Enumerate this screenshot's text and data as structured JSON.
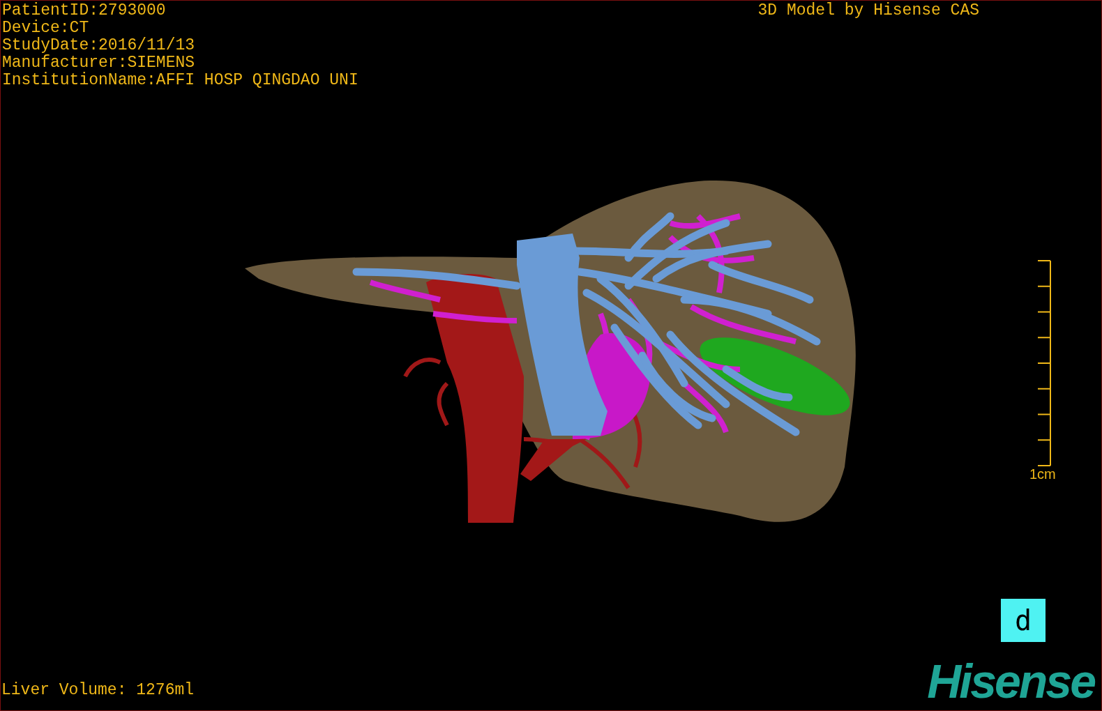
{
  "patient_info": [
    "PatientID:2793000",
    "Device:CT",
    "StudyDate:2016/11/13",
    "Manufacturer:SIEMENS",
    "InstitutionName:AFFI HOSP QINGDAO UNI"
  ],
  "title": "3D Model by Hisense CAS",
  "scale": {
    "label": "1cm"
  },
  "orientation_cube": {
    "label": "d"
  },
  "liver_volume": "Liver Volume: 1276ml",
  "logo": "Hisense"
}
